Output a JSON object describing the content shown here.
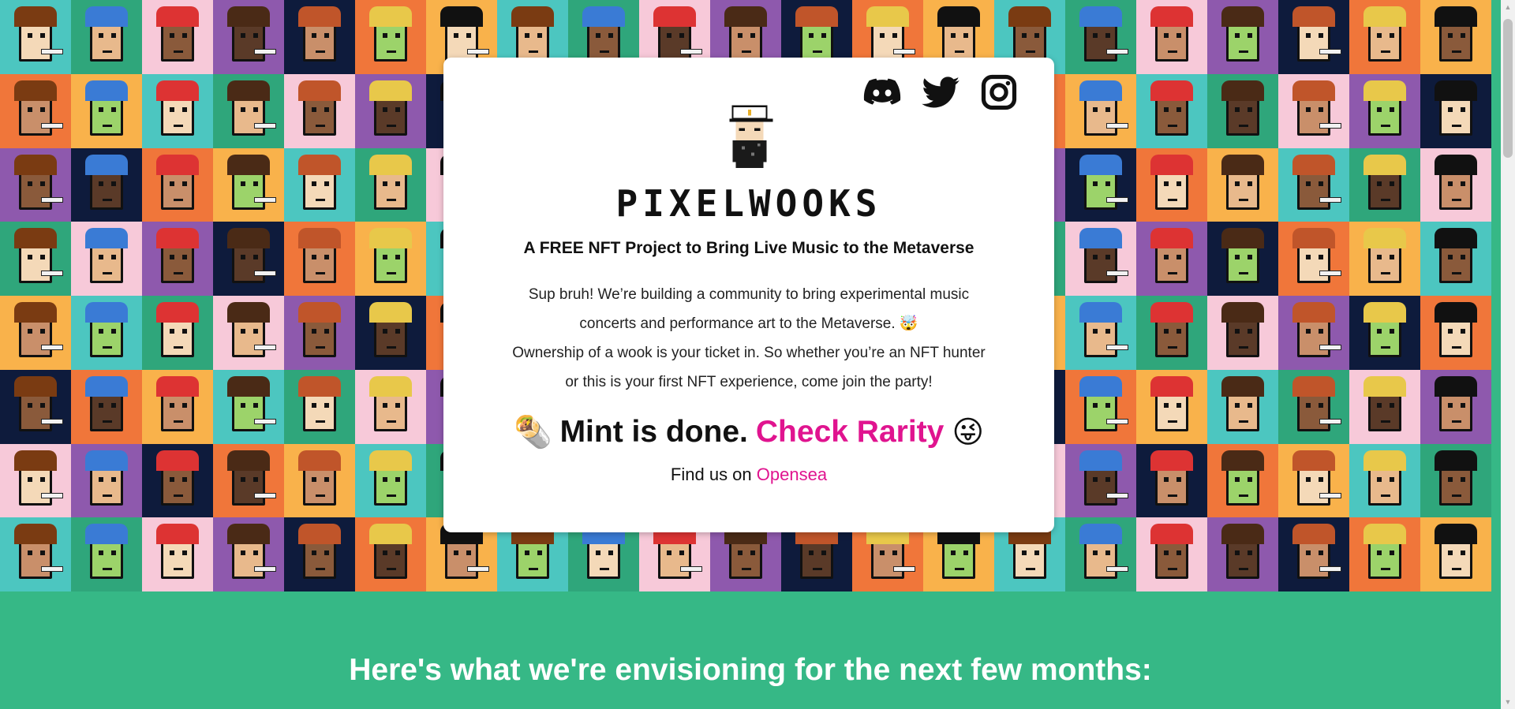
{
  "socials": [
    {
      "name": "discord-icon"
    },
    {
      "name": "twitter-icon"
    },
    {
      "name": "instagram-icon"
    }
  ],
  "brand": {
    "logo_text": "PIXELWOOKS",
    "tagline": "A FREE NFT Project to Bring Live Music to the Metaverse"
  },
  "intro": {
    "line1": "Sup bruh! We’re building a community to bring experimental music",
    "line2": "concerts and performance art to the Metaverse. 🤯",
    "line3": "Ownership of a wook is your ticket in. So whether you’re an NFT hunter",
    "line4": "or this is your first NFT experience, come join the party!"
  },
  "mint": {
    "emoji_start": "🌯",
    "text": "Mint is done.",
    "rarity_link": "Check Rarity",
    "emoji_end": "😜"
  },
  "find": {
    "prefix": "Find us on",
    "link": "Opensea"
  },
  "vision": {
    "heading": "Here's what we're envisioning for the next few months:"
  },
  "colors": {
    "accent_pink": "#e0148f",
    "section_green": "#36b886",
    "tile_palette": [
      "#4cc6c0",
      "#f0763a",
      "#8e59ad",
      "#2fa67b",
      "#f9b24b",
      "#0e1b3c",
      "#f7c9d9"
    ]
  }
}
